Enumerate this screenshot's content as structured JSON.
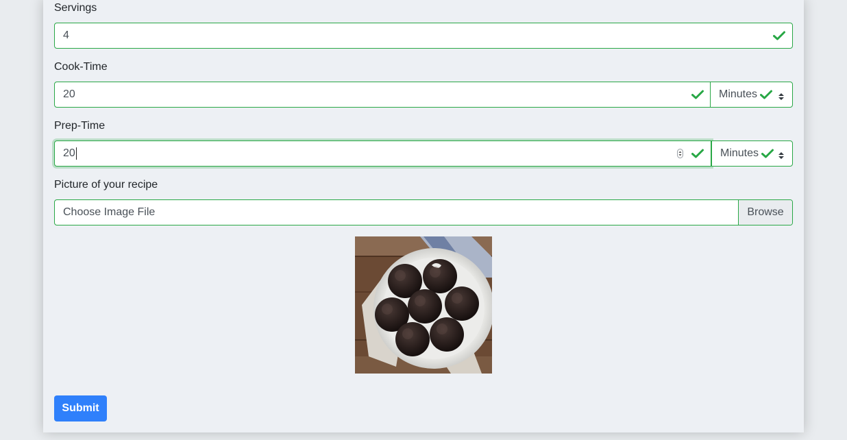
{
  "form": {
    "servings": {
      "label": "Servings",
      "value": "4"
    },
    "cook_time": {
      "label": "Cook-Time",
      "value": "20",
      "unit": "Minutes"
    },
    "prep_time": {
      "label": "Prep-Time",
      "value": "20",
      "unit": "Minutes"
    },
    "picture": {
      "label": "Picture of your recipe",
      "file_placeholder": "Choose Image File",
      "browse_label": "Browse"
    },
    "submit_label": "Submit"
  },
  "colors": {
    "valid": "#28a745",
    "primary": "#2f80fb",
    "card_bg": "#edf0f4"
  },
  "icons": {
    "valid": "check-icon",
    "select": "updown-arrows-icon",
    "number_spinner": "number-spinner-icon"
  },
  "image": {
    "subject": "chocolate-muffins-on-plate"
  }
}
